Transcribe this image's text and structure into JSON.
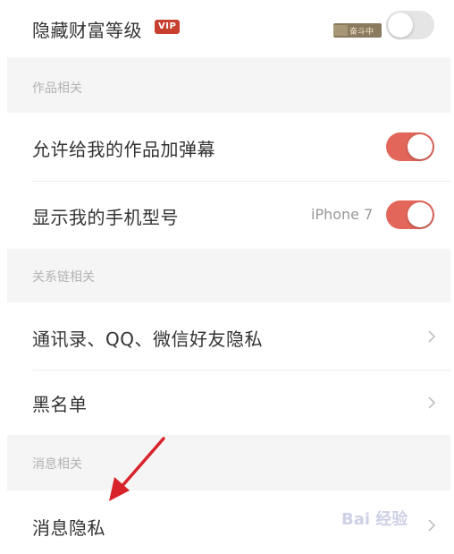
{
  "rows": {
    "hide_wealth": {
      "label": "隐藏财富等级",
      "vip_badge": "VIP",
      "fortune_badge": "奋斗中",
      "toggle_on": false
    },
    "allow_danmaku": {
      "label": "允许给我的作品加弹幕",
      "toggle_on": true
    },
    "show_phone_model": {
      "label": "显示我的手机型号",
      "model": "iPhone 7",
      "toggle_on": true
    },
    "contacts_privacy": {
      "label": "通讯录、QQ、微信好友隐私"
    },
    "blacklist": {
      "label": "黑名单"
    },
    "message_privacy": {
      "label": "消息隐私"
    }
  },
  "sections": {
    "works": "作品相关",
    "relations": "关系链相关",
    "messages": "消息相关"
  },
  "colors": {
    "toggle_on": "#e2665a",
    "toggle_off": "#e5e5e5",
    "section_bg": "#f5f5f5",
    "annotation_arrow": "#d9232a"
  },
  "watermark": "Bai 经验"
}
